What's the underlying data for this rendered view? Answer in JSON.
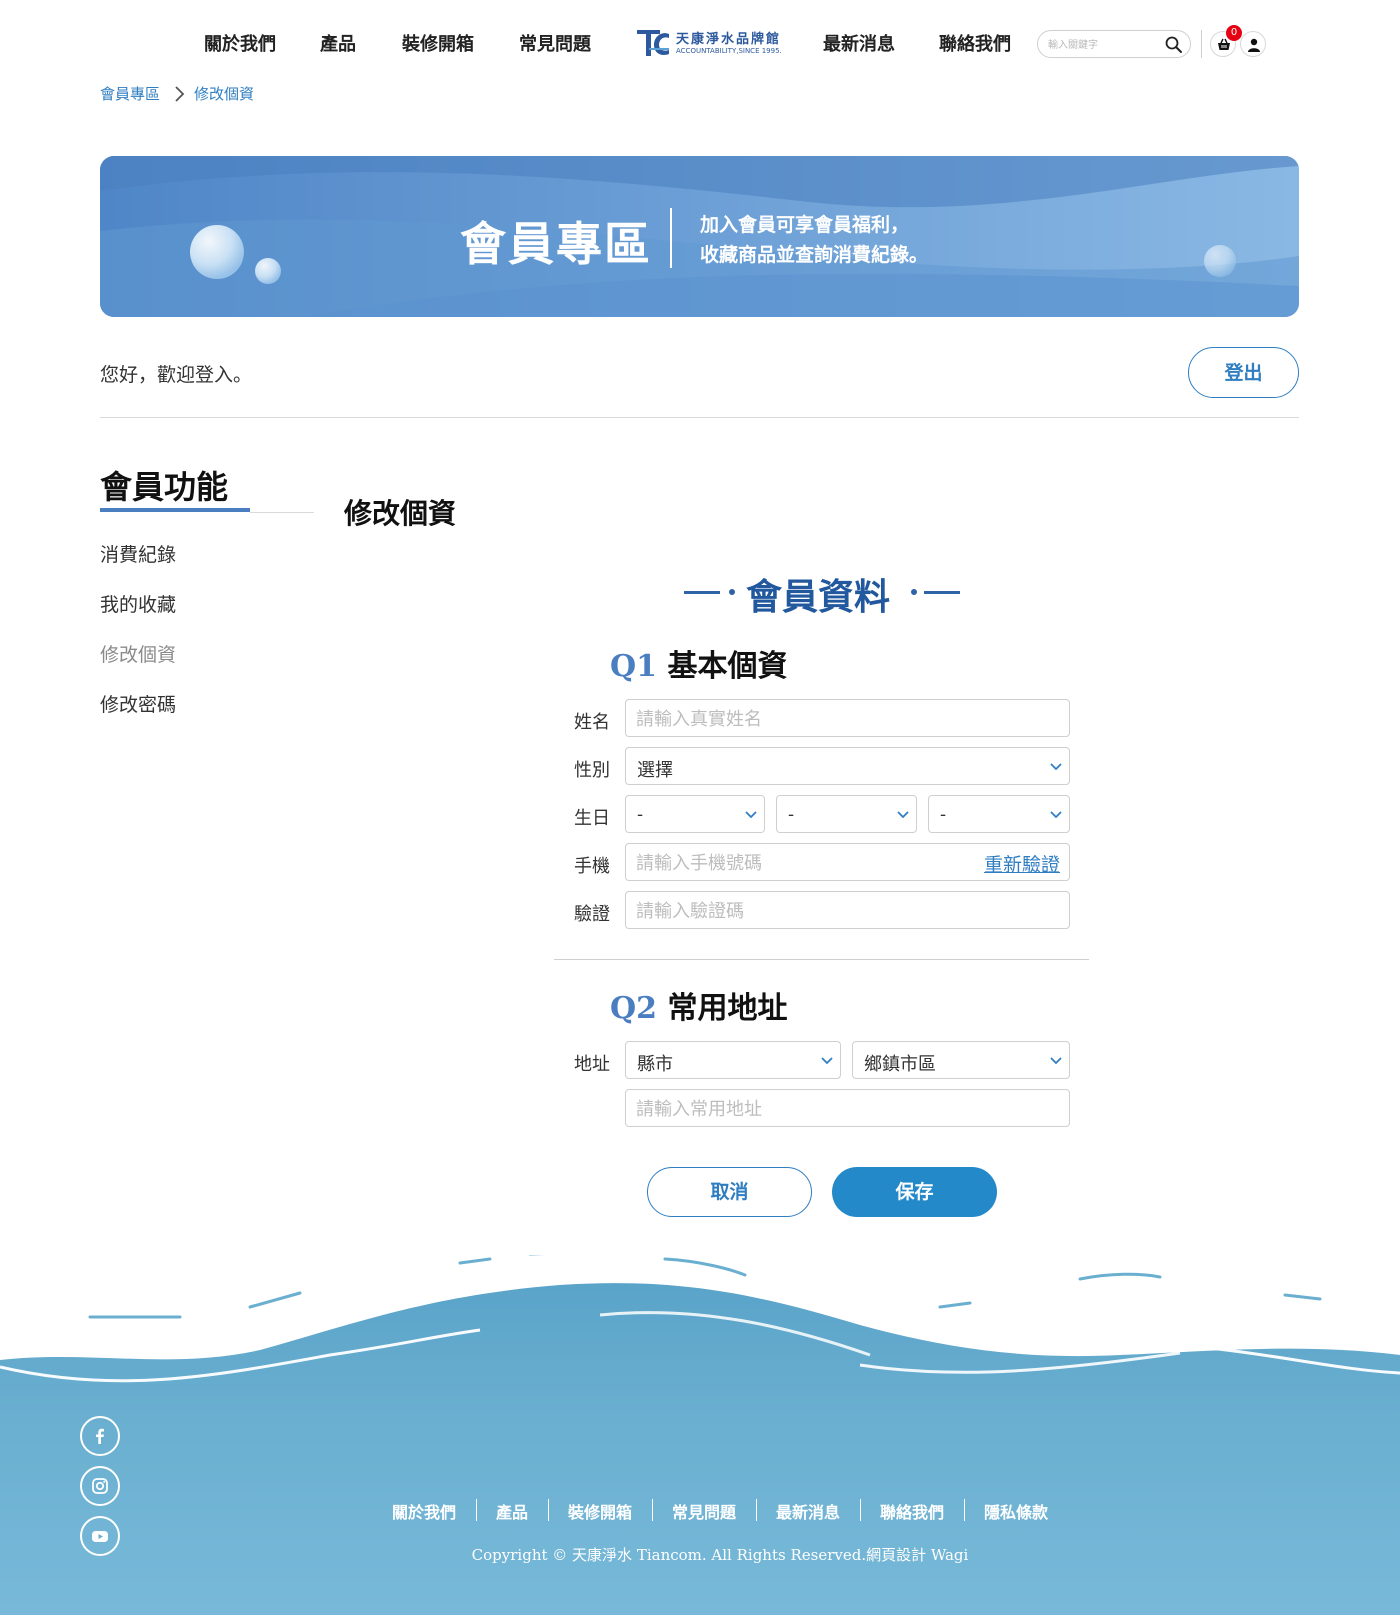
{
  "header": {
    "nav_left": [
      "關於我們",
      "產品",
      "裝修開箱",
      "常見問題"
    ],
    "nav_right": [
      "最新消息",
      "聯絡我們"
    ],
    "logo": {
      "brand_cn": "天康淨水品牌館",
      "brand_en": "ACCOUNTABILITY,SINCE 1995."
    },
    "search": {
      "placeholder": "輸入關鍵字",
      "icon": "search-icon"
    },
    "cart": {
      "count": "0",
      "icon": "basket-icon"
    },
    "account": {
      "icon": "user-icon"
    },
    "brand_color": "#2d5a9e"
  },
  "breadcrumb": {
    "items": [
      "會員專區",
      "修改個資"
    ],
    "separator_icon": "chevron-right-icon"
  },
  "banner": {
    "title": "會員專區",
    "line1": "加入會員可享會員福利，",
    "line2": "收藏商品並查詢消費紀錄。"
  },
  "welcome": {
    "text": "您好，歡迎登入。",
    "logout_label": "登出"
  },
  "sidebar": {
    "title": "會員功能",
    "items": [
      {
        "label": "消費紀錄",
        "active": false
      },
      {
        "label": "我的收藏",
        "active": false
      },
      {
        "label": "修改個資",
        "active": true
      },
      {
        "label": "修改密碼",
        "active": false
      }
    ]
  },
  "main": {
    "title": "修改個資",
    "section_title": "會員資料",
    "q1": {
      "number": "Q1",
      "title": "基本個資",
      "name_label": "姓名",
      "name_placeholder": "請輸入真實姓名",
      "gender_label": "性別",
      "gender_value": "選擇",
      "birthday_label": "生日",
      "birthday_year": "-",
      "birthday_month": "-",
      "birthday_day": "-",
      "phone_label": "手機",
      "phone_placeholder": "請輸入手機號碼",
      "reverify_label": "重新驗證",
      "verify_label": "驗證",
      "verify_placeholder": "請輸入驗證碼"
    },
    "q2": {
      "number": "Q2",
      "title": "常用地址",
      "address_label": "地址",
      "county_value": "縣市",
      "district_value": "鄉鎮市區",
      "address_placeholder": "請輸入常用地址"
    },
    "cancel_label": "取消",
    "save_label": "保存",
    "accent_color": "#2489c9"
  },
  "footer": {
    "nav": [
      "關於我們",
      "產品",
      "裝修開箱",
      "常見問題",
      "最新消息",
      "聯絡我們",
      "隱私條款"
    ],
    "copyright": "Copyright © 天康淨水 Tiancom. All Rights Reserved.網頁設計 Wagi",
    "social": [
      "facebook-icon",
      "instagram-icon",
      "youtube-icon"
    ],
    "wave_color": "#6aafd0"
  }
}
